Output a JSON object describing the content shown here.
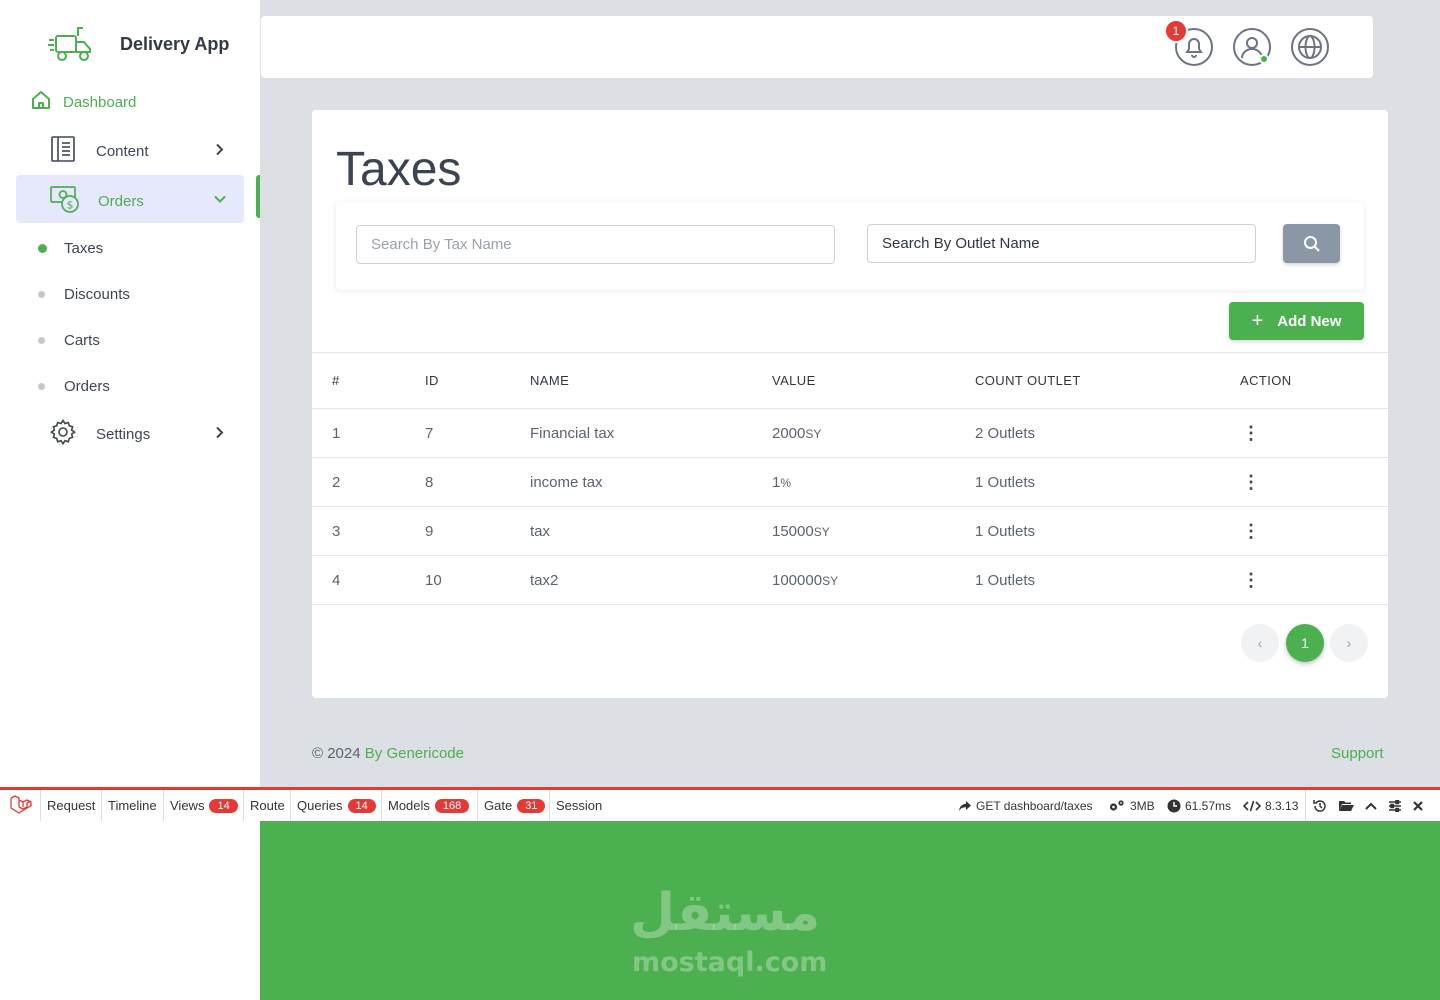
{
  "brand": {
    "title": "Delivery App",
    "logo_icon": "delivery-truck-icon"
  },
  "sidebar": {
    "dashboard": "Dashboard",
    "content": "Content",
    "orders": "Orders",
    "sub_items": [
      "Taxes",
      "Discounts",
      "Carts",
      "Orders"
    ],
    "settings": "Settings"
  },
  "topbar": {
    "notification_count": "1"
  },
  "page": {
    "title": "Taxes",
    "search_tax_placeholder": "Search By Tax Name",
    "search_outlet_value": "Search By Outlet Name",
    "add_new": "Add New"
  },
  "table": {
    "headers": [
      "#",
      "ID",
      "NAME",
      "VALUE",
      "COUNT OUTLET",
      "ACTION"
    ],
    "rows": [
      {
        "index": "1",
        "id": "7",
        "name": "Financial tax",
        "value": "2000",
        "unit": "SY",
        "count": "2 Outlets"
      },
      {
        "index": "2",
        "id": "8",
        "name": "income tax",
        "value": "1",
        "unit": "%",
        "count": "1 Outlets"
      },
      {
        "index": "3",
        "id": "9",
        "name": "tax",
        "value": "15000",
        "unit": "SY",
        "count": "1 Outlets"
      },
      {
        "index": "4",
        "id": "10",
        "name": "tax2",
        "value": "100000",
        "unit": "SY",
        "count": "1 Outlets"
      }
    ]
  },
  "pagination": {
    "prev": "‹",
    "current": "1",
    "next": "›"
  },
  "footer": {
    "copyright": "© 2024 ",
    "author": "By Genericode",
    "support": "Support"
  },
  "debugbar": {
    "tabs": [
      {
        "label": "Request"
      },
      {
        "label": "Timeline"
      },
      {
        "label": "Views",
        "badge": "14"
      },
      {
        "label": "Route"
      },
      {
        "label": "Queries",
        "badge": "14"
      },
      {
        "label": "Models",
        "badge": "168"
      },
      {
        "label": "Gate",
        "badge": "31"
      },
      {
        "label": "Session"
      }
    ],
    "route": "GET dashboard/taxes",
    "memory": "3MB",
    "time": "61.57ms",
    "php_version": "8.3.13"
  },
  "watermark": {
    "arabic": "مستقل",
    "latin": "mostaql.com"
  },
  "colors": {
    "accent": "#4caf50",
    "badge": "#e53935",
    "active_bg": "#e6e8fb",
    "search_button": "#8b97a6"
  }
}
